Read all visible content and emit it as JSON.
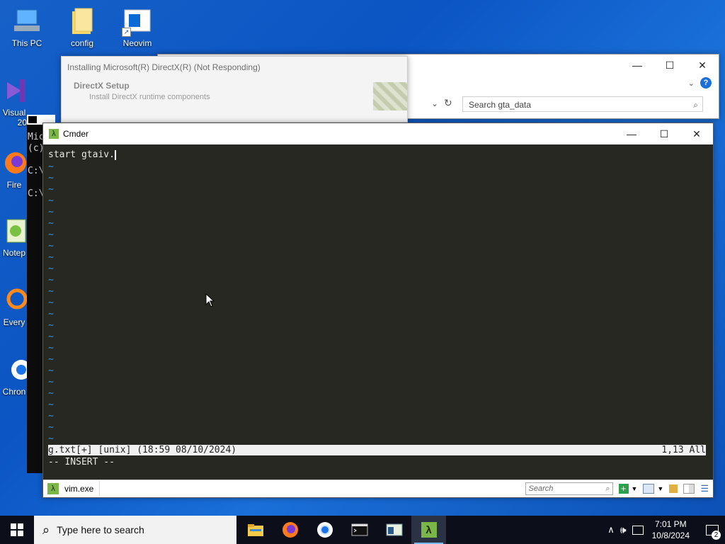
{
  "desktop": {
    "icons": [
      {
        "label": "This PC"
      },
      {
        "label": "config"
      },
      {
        "label": "Neovim"
      },
      {
        "label": "Visual"
      },
      {
        "label": "Fire"
      },
      {
        "label": "Notep"
      },
      {
        "label": "Every"
      },
      {
        "label": "Chron"
      }
    ],
    "vs_extra": "20"
  },
  "cmd_window": {
    "lines": [
      "Mic",
      "(c)",
      "C:\\",
      "C:\\"
    ]
  },
  "explorer": {
    "search_placeholder": "Search gta_data"
  },
  "dx_setup": {
    "title": "Installing Microsoft(R) DirectX(R) (Not Responding)",
    "heading": "DirectX Setup",
    "subtitle": "Install DirectX runtime components"
  },
  "cmder": {
    "title": "Cmder",
    "buffer_line": "start gtaiv.",
    "status_left": "g.txt[+] [unix] (18:59 08/10/2024)",
    "status_right": "1,13 All",
    "mode_line": "-- INSERT --",
    "tab_label": "vim.exe",
    "search_placeholder": "Search"
  },
  "taskbar": {
    "search_placeholder": "Type here to search",
    "time": "7:01 PM",
    "date": "10/8/2024",
    "notification_count": "2"
  },
  "colors": {
    "desktop_blue": "#0b55c4",
    "terminal_bg": "#272822",
    "tilde_blue": "#3a8fd1",
    "status_bar_bg": "#f0f0f0"
  }
}
